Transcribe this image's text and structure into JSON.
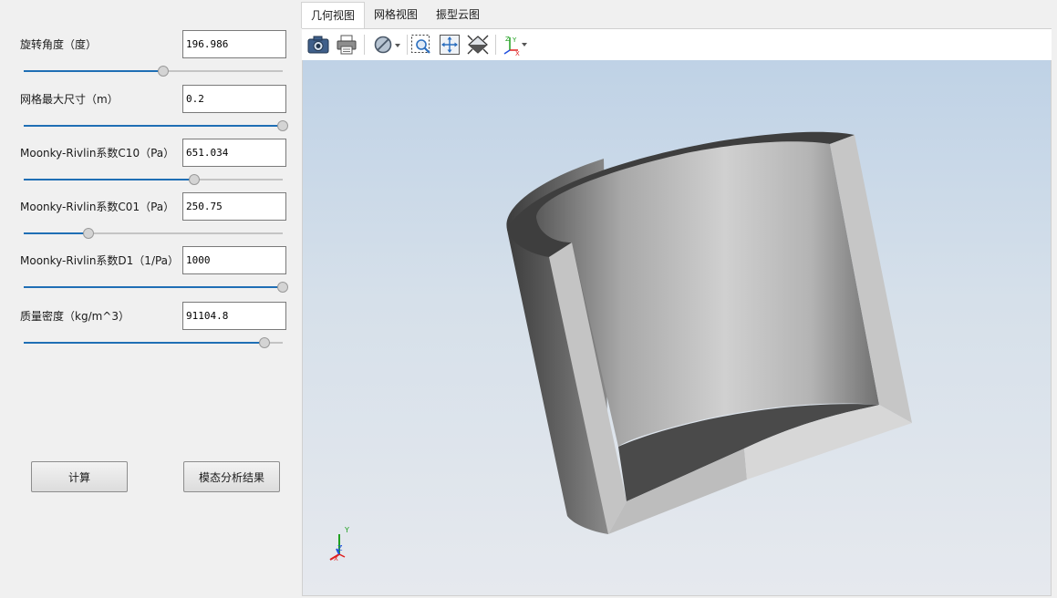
{
  "params": [
    {
      "label": "旋转角度（度）",
      "value": "196.986",
      "slider_fraction": 0.54
    },
    {
      "label": "网格最大尺寸（m）",
      "value": "0.2",
      "slider_fraction": 1.0
    },
    {
      "label": "Moonky-Rivlin系数C10（Pa）",
      "value": "651.034",
      "slider_fraction": 0.66
    },
    {
      "label": "Moonky-Rivlin系数C01（Pa）",
      "value": "250.75",
      "slider_fraction": 0.25
    },
    {
      "label": "Moonky-Rivlin系数D1（1/Pa）",
      "value": "1000",
      "slider_fraction": 1.0
    },
    {
      "label": "质量密度（kg/m^3）",
      "value": "91104.8",
      "slider_fraction": 0.93
    }
  ],
  "buttons": {
    "compute": "计算",
    "modal_results": "模态分析结果"
  },
  "tabs": [
    {
      "label": "几何视图",
      "active": true
    },
    {
      "label": "网格视图",
      "active": false
    },
    {
      "label": "振型云图",
      "active": false
    }
  ],
  "toolbar_icons": [
    "camera-icon",
    "print-icon",
    "display-mode-icon",
    "zoom-box-icon",
    "fit-all-icon",
    "view-orientation-icon",
    "axes-icon"
  ],
  "axis_triad": {
    "x": "X",
    "y": "Y",
    "z": "Z"
  },
  "colors": {
    "slider_fill": "#1f6fb5",
    "viewport_top": "#bfd2e6",
    "viewport_bottom": "#e6e9ee",
    "triad_x": "#e02020",
    "triad_y": "#1fa01f",
    "triad_z": "#2050e0"
  }
}
